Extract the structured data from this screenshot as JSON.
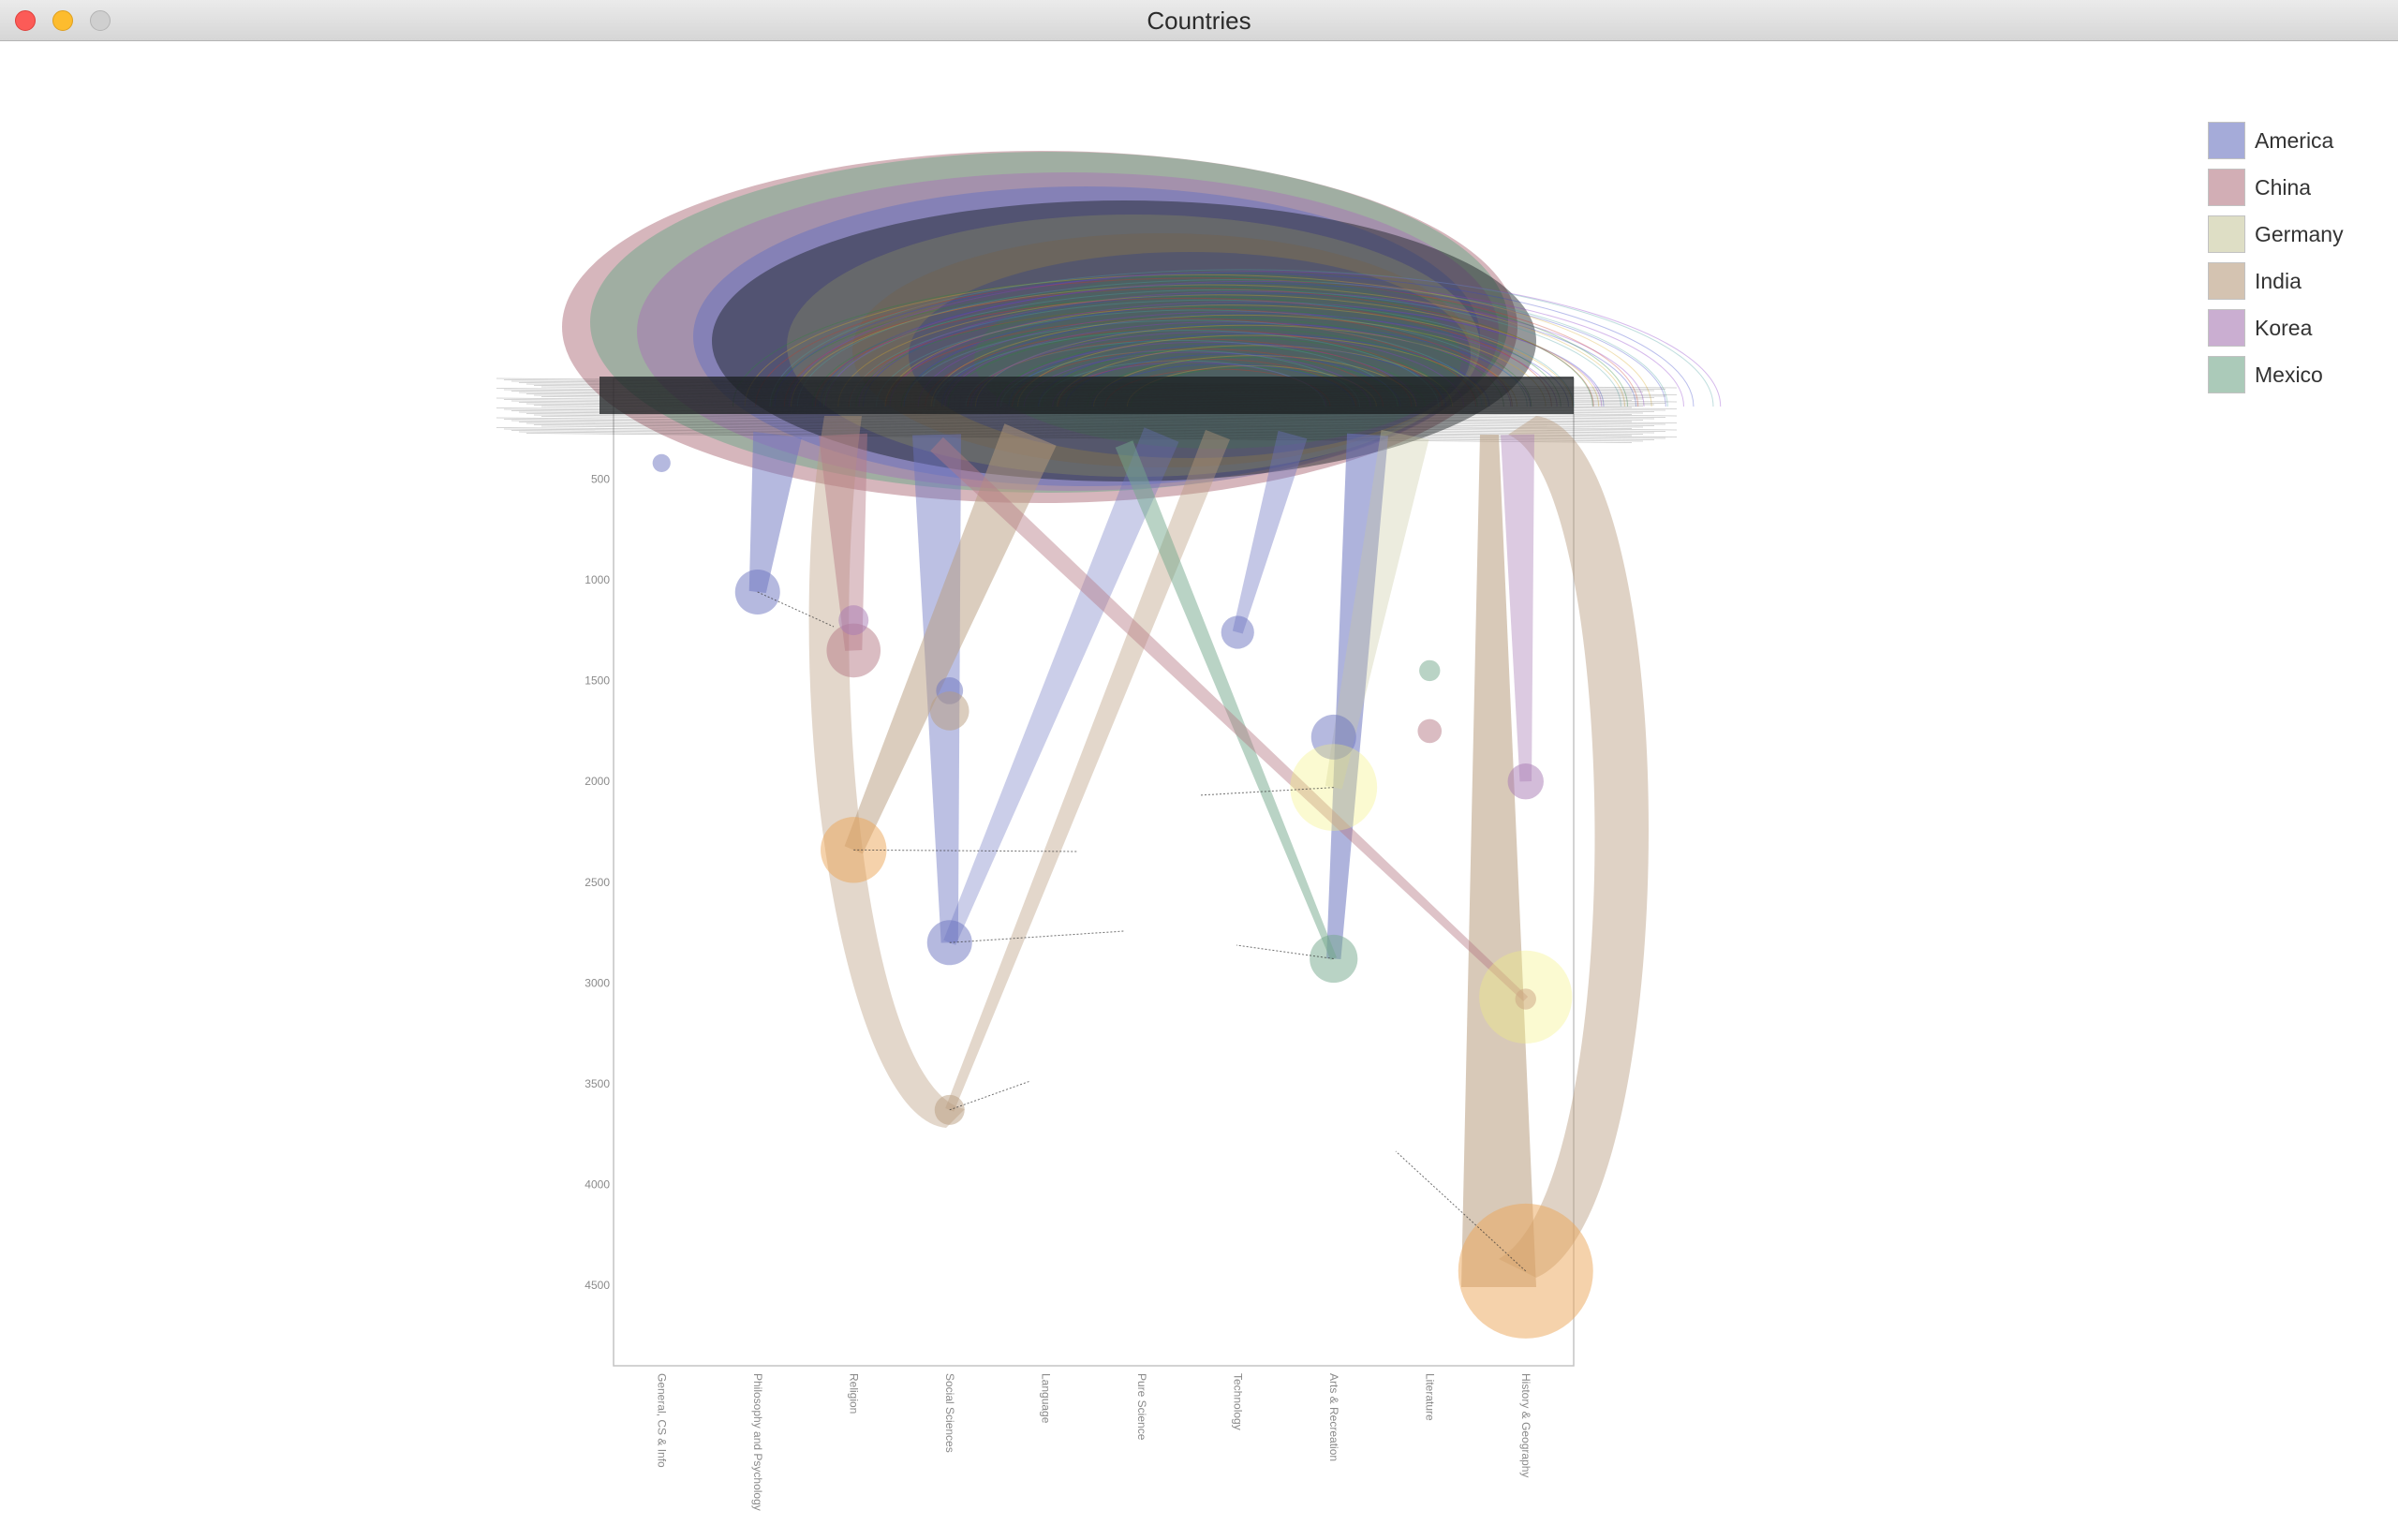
{
  "window": {
    "title": "Countries"
  },
  "colors": {
    "America": "#6b74c0",
    "China": "#b57a85",
    "Germany": "#c9c9a0",
    "India": "#b89c7e",
    "Korea": "#a77ab4",
    "Mexico": "#74a88c",
    "bubble_yellow": "#f3f07a",
    "bubble_orange": "#eba658",
    "dark_overlay": "#141a1e"
  },
  "chart_data": {
    "type": "scatter",
    "title": "",
    "xlabel": "",
    "ylabel": "",
    "categories": [
      "General, CS & Info",
      "Philosophy and Psychology",
      "Religion",
      "Social Sciences",
      "Language",
      "Pure Science",
      "Technology",
      "Arts & Recreation",
      "Literature",
      "History & Geography"
    ],
    "y_ticks": [
      "500",
      "1000",
      "1500",
      "2000",
      "2500",
      "3000",
      "3500",
      "4000",
      "4500"
    ],
    "ylim": [
      0,
      4900
    ],
    "y_inverted": true,
    "legend": {
      "position": "top-right",
      "entries": [
        "America",
        "China",
        "Germany",
        "India",
        "Korea",
        "Mexico"
      ]
    },
    "series": [
      {
        "name": "America",
        "points": [
          {
            "category": "Philosophy and Psychology",
            "y": 1060,
            "size": 30
          },
          {
            "category": "Social Sciences",
            "y": 2800,
            "size": 30
          },
          {
            "category": "Social Sciences",
            "y": 1550,
            "size": 18
          },
          {
            "category": "Technology",
            "y": 1260,
            "size": 22
          },
          {
            "category": "Arts & Recreation",
            "y": 1780,
            "size": 30
          },
          {
            "category": "General, CS & Info",
            "y": 420,
            "size": 12
          }
        ]
      },
      {
        "name": "China",
        "points": [
          {
            "category": "Religion",
            "y": 1350,
            "size": 36
          },
          {
            "category": "History & Geography",
            "y": 3080,
            "size": 14
          },
          {
            "category": "Literature",
            "y": 1750,
            "size": 16
          }
        ]
      },
      {
        "name": "Germany",
        "points": [
          {
            "category": "Arts & Recreation",
            "y": 2030,
            "size": 58
          },
          {
            "category": "History & Geography",
            "y": 3070,
            "size": 62
          }
        ]
      },
      {
        "name": "India",
        "points": [
          {
            "category": "Religion",
            "y": 2340,
            "size": 44
          },
          {
            "category": "Social Sciences",
            "y": 3630,
            "size": 20
          },
          {
            "category": "History & Geography",
            "y": 4430,
            "size": 90
          },
          {
            "category": "Social Sciences",
            "y": 1650,
            "size": 26
          }
        ]
      },
      {
        "name": "Korea",
        "points": [
          {
            "category": "Religion",
            "y": 1200,
            "size": 20
          },
          {
            "category": "History & Geography",
            "y": 2000,
            "size": 24
          }
        ]
      },
      {
        "name": "Mexico",
        "points": [
          {
            "category": "Arts & Recreation",
            "y": 2880,
            "size": 32
          },
          {
            "category": "Literature",
            "y": 1450,
            "size": 14
          }
        ]
      }
    ]
  }
}
